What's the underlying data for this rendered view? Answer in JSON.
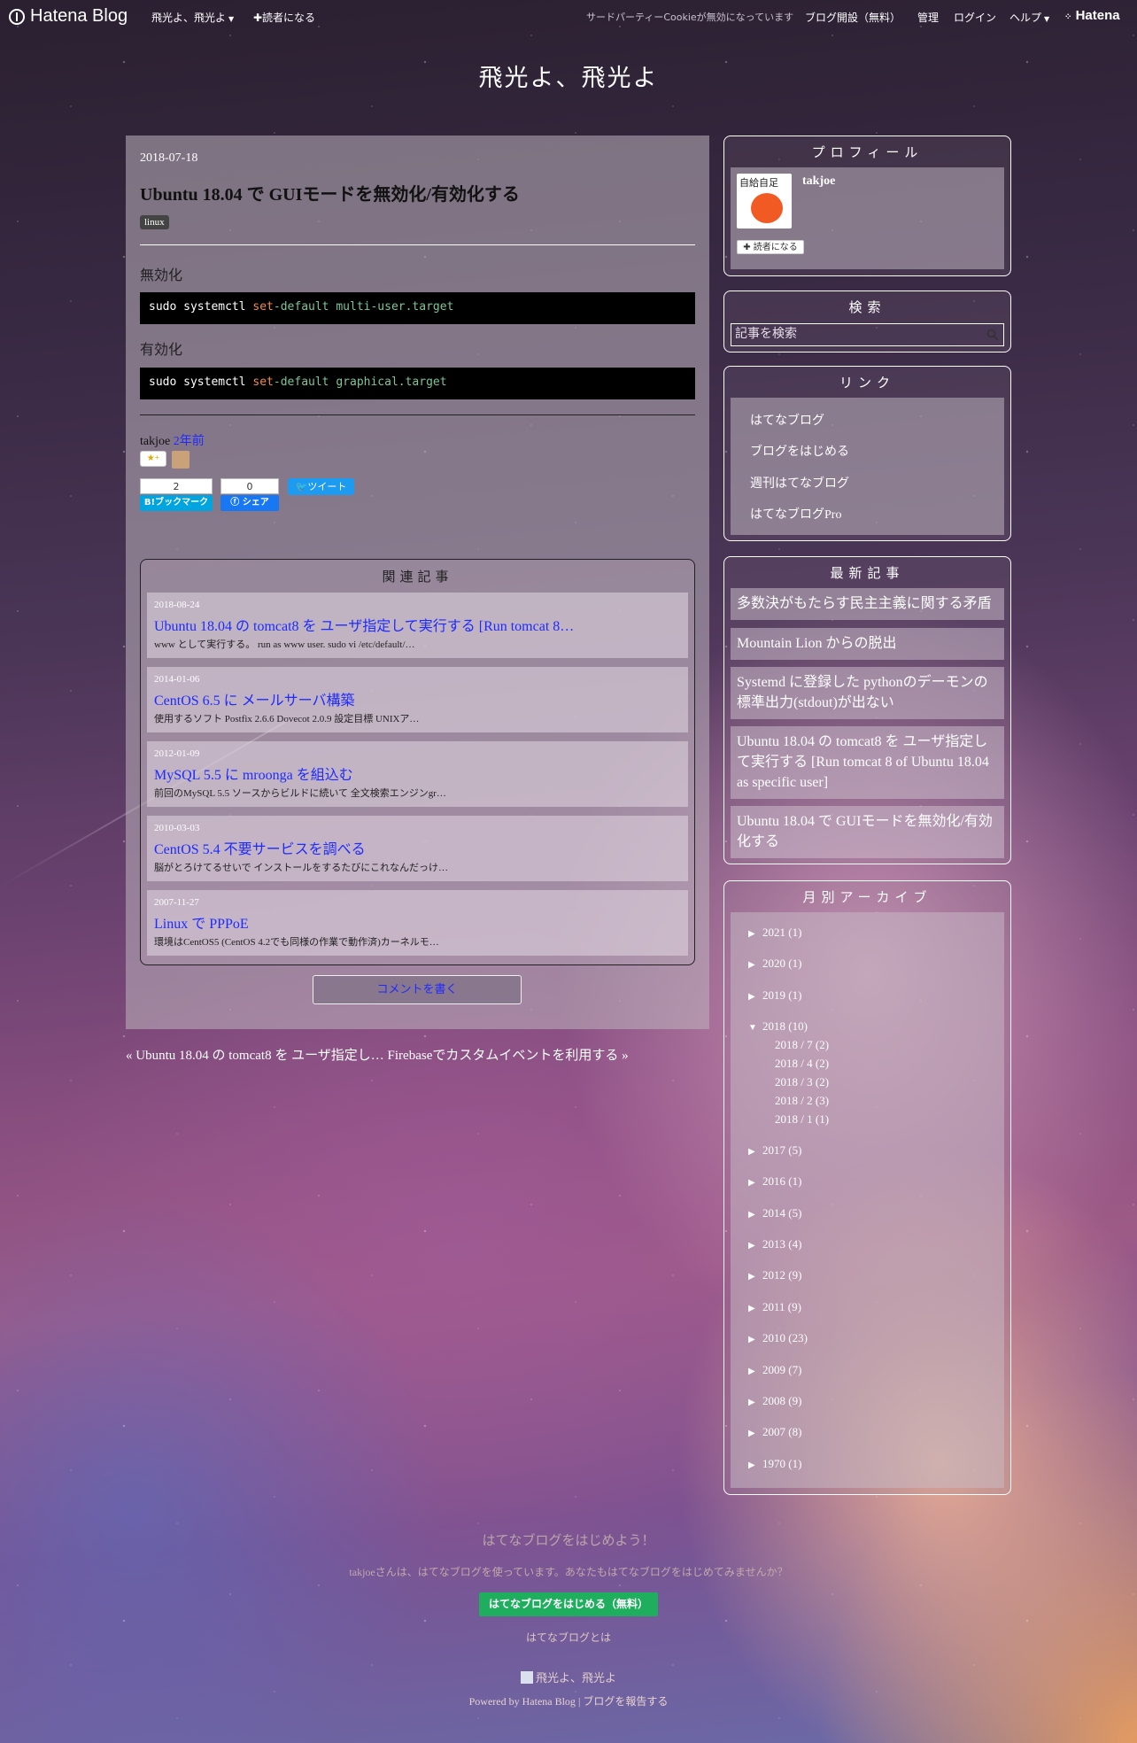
{
  "topbar": {
    "logo": "Hatena Blog",
    "blog_menu": "飛光よ、飛光よ",
    "subscribe": "✚読者になる",
    "cookie_notice": "サードパーティーCookieが無効になっています",
    "open_blog": "ブログ開設（無料）",
    "admin": "管理",
    "login": "ログイン",
    "help": "ヘルプ",
    "hatena": "Hatena"
  },
  "blog_title": "飛光よ、飛光よ",
  "entry": {
    "date": "2018-07-18",
    "title": "Ubuntu 18.04 で GUIモードを無効化/有効化する",
    "tag": "linux",
    "disable_head": "無効化",
    "disable_code": {
      "cmd": "sudo systemctl ",
      "set": "set",
      "rest": "-default ",
      "target": "multi-user.target"
    },
    "enable_head": "有効化",
    "enable_code": {
      "cmd": "sudo systemctl ",
      "set": "set",
      "rest": "-default ",
      "target": "graphical.target"
    },
    "author": "takjoe",
    "time_ago": "2年前",
    "star_add": "★+",
    "hatebu_count": "2",
    "hatebu_label": "B!ブックマーク",
    "fb_count": "0",
    "fb_label": "シェア",
    "tweet_label": "ツイート"
  },
  "related": {
    "title": "関連記事",
    "items": [
      {
        "date": "2018-08-24",
        "title": "Ubuntu 18.04 の tomcat8 を ユーザ指定して実行する [Run tomcat 8…",
        "snippet": "www として実行する。 run as www user. sudo vi /etc/default/…"
      },
      {
        "date": "2014-01-06",
        "title": "CentOS 6.5 に メールサーバ構築",
        "snippet": "使用するソフト Postfix 2.6.6 Dovecot 2.0.9 設定目標 UNIXア…"
      },
      {
        "date": "2012-01-09",
        "title": "MySQL 5.5 に mroonga を組込む",
        "snippet": "前回のMySQL 5.5 ソースからビルドに続いて 全文検索エンジンgr…"
      },
      {
        "date": "2010-03-03",
        "title": "CentOS 5.4 不要サービスを調べる",
        "snippet": "脳がとろけてるせいで インストールをするたびにこれなんだっけ…"
      },
      {
        "date": "2007-11-27",
        "title": "Linux で PPPoE",
        "snippet": "環境はCentOS5 (CentOS 4.2でも同様の作業で動作済)カーネルモ…"
      }
    ]
  },
  "comment_button": "コメントを書く",
  "pager": {
    "prev": "« Ubuntu 18.04 の tomcat8 を ユーザ指定し…",
    "next": "Firebaseでカスタムイベントを利用する »"
  },
  "sidebar": {
    "profile": {
      "title": "プロフィール",
      "name": "takjoe",
      "avatar_text": "自給自足",
      "follow": "✚ 読者になる"
    },
    "search": {
      "title": "検索",
      "placeholder": "記事を検索"
    },
    "links": {
      "title": "リンク",
      "items": [
        "はてなブログ",
        "ブログをはじめる",
        "週刊はてなブログ",
        "はてなブログPro"
      ]
    },
    "recent": {
      "title": "最新記事",
      "items": [
        "多数決がもたらす民主主義に関する矛盾",
        "Mountain Lion からの脱出",
        "Systemd に登録した pythonのデーモンの標準出力(stdout)が出ない",
        "Ubuntu 18.04 の tomcat8 を ユーザ指定して実行する [Run tomcat 8 of Ubuntu 18.04 as specific user]",
        "Ubuntu 18.04 で GUIモードを無効化/有効化する"
      ]
    },
    "archive": {
      "title": "月別アーカイブ",
      "years": [
        "2021 (1)",
        "2020 (1)",
        "2019 (1)",
        "2018 (10)",
        "2017 (5)",
        "2016 (1)",
        "2014 (5)",
        "2013 (4)",
        "2012 (9)",
        "2011 (9)",
        "2010 (23)",
        "2009 (7)",
        "2008 (9)",
        "2007 (8)",
        "1970 (1)"
      ],
      "months_2018": [
        "2018 / 7 (2)",
        "2018 / 4 (2)",
        "2018 / 3 (2)",
        "2018 / 2 (3)",
        "2018 / 1 (1)"
      ]
    }
  },
  "footer": {
    "promo_title": "はてなブログをはじめよう！",
    "promo_sub": "takjoeさんは、はてなブログを使っています。あなたもはてなブログをはじめてみませんか？",
    "promo_button": "はてなブログをはじめる（無料）",
    "promo_link": "はてなブログとは",
    "blog_name": "飛光よ、飛光よ",
    "powered": "Powered by Hatena Blog",
    "report": "ブログを報告する"
  }
}
